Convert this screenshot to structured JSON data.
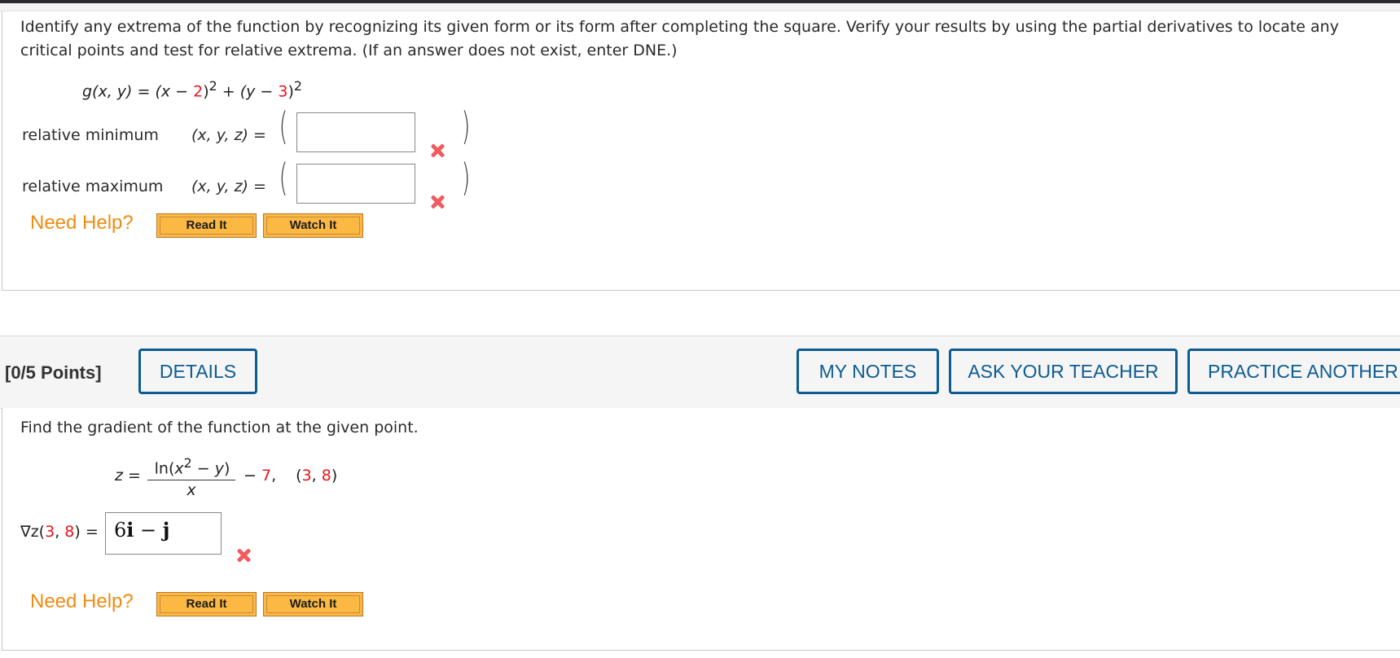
{
  "question1": {
    "prompt": "Identify any extrema of the function by recognizing its given form or its form after completing the square. Verify your results by using the partial derivatives to locate any critical points and test for relative extrema. (If an answer does not exist, enter DNE.)",
    "prompt_line1": "Identify any extrema of the function by recognizing its given form or its form after completing the square. Verify your results by using the partial derivatives to locate any",
    "prompt_line2": "critical points and test for relative extrema. (If an answer does not exist, enter DNE.)",
    "function": {
      "lhs": "g(x, y)",
      "eq": " = ",
      "t1_open": "(x − ",
      "t1_const": "2",
      "t1_close": ")",
      "exp": "2",
      "plus": " + ",
      "t2_open": "(y − ",
      "t2_const": "3",
      "t2_close": ")"
    },
    "rows": [
      {
        "label": "relative minimum",
        "tuple": "(x, y, z)  =",
        "value": "",
        "status": "incorrect"
      },
      {
        "label": "relative maximum",
        "tuple": "(x, y, z)  =",
        "value": "",
        "status": "incorrect"
      }
    ],
    "help": {
      "label": "Need Help?",
      "read": "Read It",
      "watch": "Watch It"
    }
  },
  "question2": {
    "points": "[0/5 Points]",
    "details": "DETAILS",
    "my_notes": "MY NOTES",
    "ask_teacher": "ASK YOUR TEACHER",
    "practice": "PRACTICE ANOTHER",
    "prompt": "Find the gradient of the function at the given point.",
    "function": {
      "lhs": "z =",
      "numerator": "ln(x² − y)",
      "num_ln": "ln(",
      "num_x": "x",
      "num_exp": "2",
      "num_rest": " − ",
      "num_y": "y",
      "num_close": ")",
      "denominator": "x",
      "minus": "− ",
      "const": "7",
      "comma": ",",
      "point_open": "(",
      "px": "3",
      "sep": ", ",
      "py": "8",
      "point_close": ")"
    },
    "gradient_label": {
      "nabla": "∇z(",
      "x": "3",
      "sep": ", ",
      "y": "8",
      "close": ")  ="
    },
    "answer": "6i − j",
    "answer_parts": {
      "coef": "6",
      "i": "i",
      "op": " − ",
      "j": "j"
    },
    "status": "incorrect",
    "help": {
      "label": "Need Help?",
      "read": "Read It",
      "watch": "Watch It"
    }
  },
  "colors": {
    "accent_blue": "#0d5c91",
    "help_orange": "#f18a12",
    "button_orange": "#fbb843",
    "error_red": "#f25a5f",
    "given_red": "#e8141c"
  }
}
